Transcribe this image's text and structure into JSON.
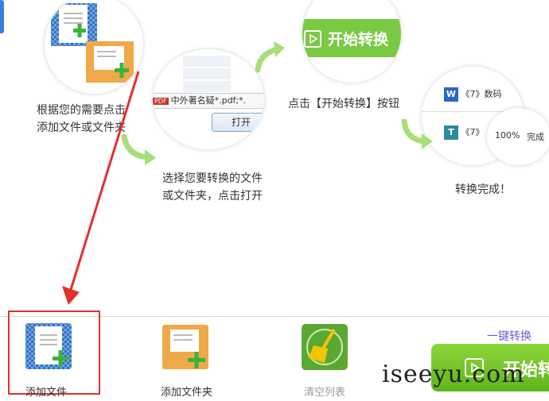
{
  "steps": {
    "step1_text_l1": "根据您的需要点击",
    "step1_text_l2": "添加文件或文件夹",
    "step2_text_l1": "选择您要转换的文件",
    "step2_text_l2": "或文件夹，点击打开",
    "step3_text": "点击【开始转换】按钮",
    "step4_text": "转换完成！"
  },
  "dialog_preview": {
    "filename": "中外著名疑",
    "filter": "*.pdf;*.",
    "open_button": "打开",
    "pdf_badge": "PDF"
  },
  "start_preview_label": "开始转换",
  "result_preview": {
    "row1": "《7》数码",
    "row2": "《7》",
    "progress": "100%",
    "done": "完成"
  },
  "toolbar": {
    "add_file": "添加文件",
    "add_folder": "添加文件夹",
    "clear_list": "清空列表",
    "one_click": "一键转换",
    "start_button": "开始转"
  },
  "watermark": "iseeyu.com",
  "colors": {
    "accent_green": "#7ac943",
    "highlight_red": "#e0312b",
    "blue_doc": "#2f73c8",
    "orange_folder": "#f0a948"
  }
}
